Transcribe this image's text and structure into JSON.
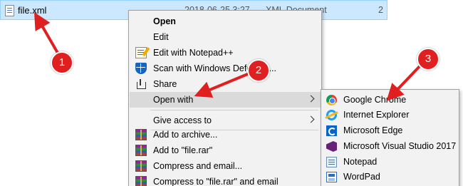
{
  "explorer": {
    "file": {
      "name": "file.xml",
      "date": "2018-06-25 3:27",
      "type": "XML Document",
      "size": "2"
    }
  },
  "context_menu": {
    "items": [
      {
        "label": "Open",
        "icon": "none"
      },
      {
        "label": "Edit",
        "icon": "none"
      },
      {
        "label": "Edit with Notepad++",
        "icon": "notepad-plus-icon"
      },
      {
        "label": "Scan with Windows Defender...",
        "icon": "windows-defender-icon"
      },
      {
        "label": "Share",
        "icon": "share-icon"
      },
      {
        "label": "Open with",
        "icon": "none"
      },
      {
        "label": "Give access to",
        "icon": "none"
      },
      {
        "label": "Add to archive...",
        "icon": "winrar-icon"
      },
      {
        "label": "Add to \"file.rar\"",
        "icon": "winrar-icon"
      },
      {
        "label": "Compress and email...",
        "icon": "winrar-icon"
      },
      {
        "label": "Compress to \"file.rar\" and email",
        "icon": "winrar-icon"
      }
    ]
  },
  "open_with_submenu": {
    "items": [
      {
        "label": "Google Chrome",
        "icon": "chrome-icon"
      },
      {
        "label": "Internet Explorer",
        "icon": "internet-explorer-icon"
      },
      {
        "label": "Microsoft Edge",
        "icon": "edge-icon"
      },
      {
        "label": "Microsoft Visual Studio 2017",
        "icon": "visual-studio-icon"
      },
      {
        "label": "Notepad",
        "icon": "notepad-icon"
      },
      {
        "label": "WordPad",
        "icon": "wordpad-icon"
      }
    ]
  },
  "callouts": [
    {
      "number": "1"
    },
    {
      "number": "2"
    },
    {
      "number": "3"
    }
  ],
  "colors": {
    "selection": "#cce8ff",
    "menu_background": "#f2f2f2",
    "menu_highlight": "#dadada",
    "callout": "#e02020"
  }
}
